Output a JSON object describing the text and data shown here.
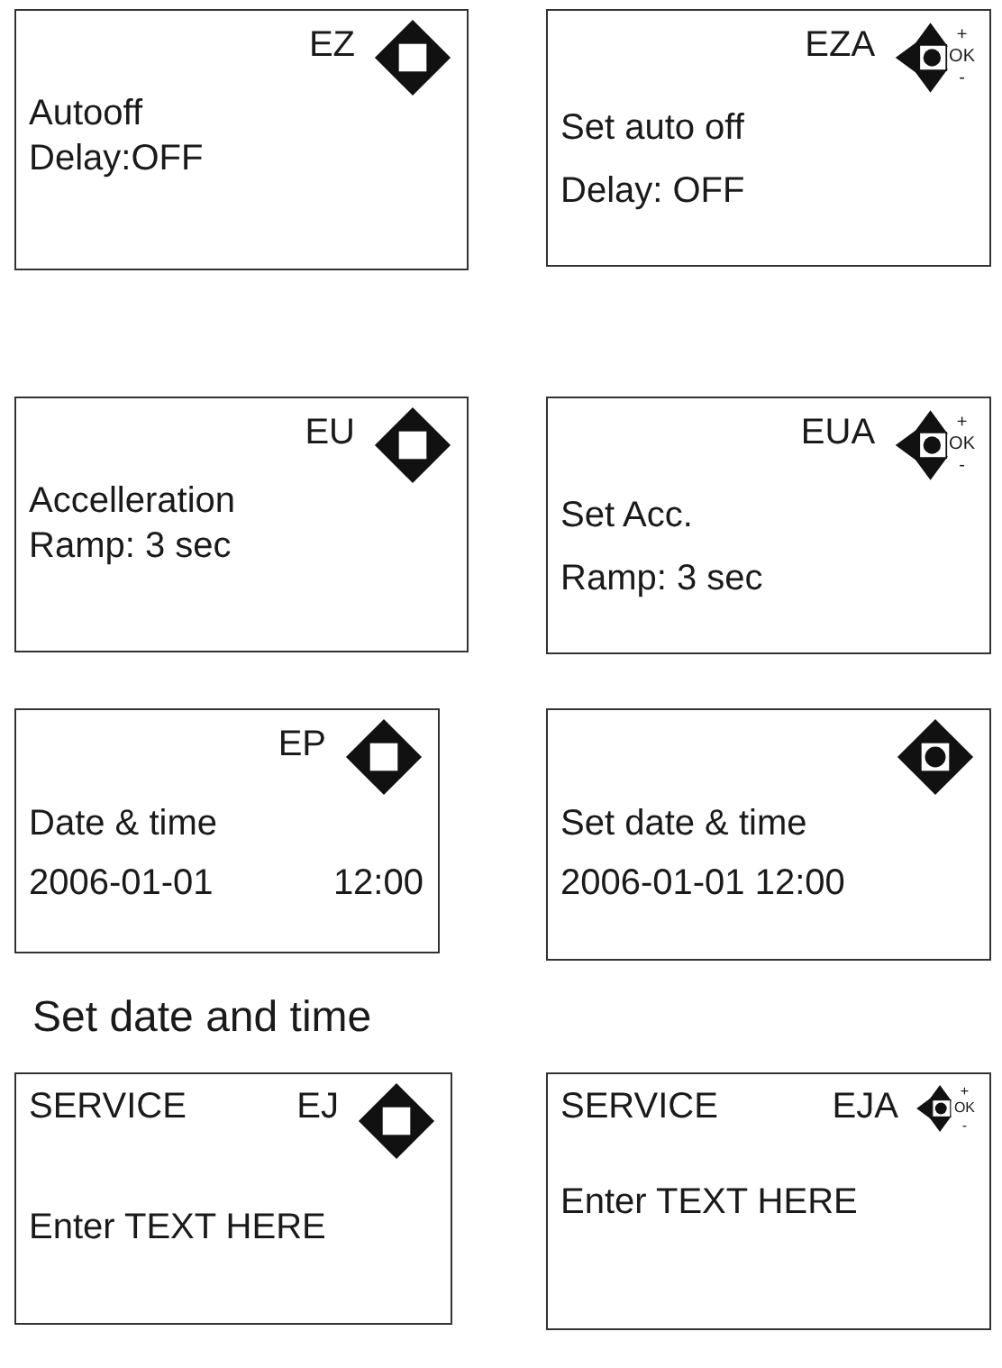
{
  "sections": [
    {
      "kind": "screens",
      "screens": [
        {
          "code": "EZ",
          "icon": {
            "kind": "nav"
          },
          "lines": [
            {
              "text": "Autooff"
            },
            {
              "text": "Delay:OFF"
            }
          ]
        },
        {
          "code": "EZA",
          "icon": {
            "kind": "edit",
            "plus": "+",
            "ok": "OK",
            "minus": "-"
          },
          "lines": [
            {
              "text": "Set auto off"
            },
            {
              "text": "Delay:  OFF"
            }
          ]
        }
      ]
    },
    {
      "kind": "screens",
      "screens": [
        {
          "code": "EU",
          "icon": {
            "kind": "nav"
          },
          "lines": [
            {
              "text": "Accelleration"
            },
            {
              "text": "Ramp: 3 sec"
            }
          ]
        },
        {
          "code": "EUA",
          "icon": {
            "kind": "edit",
            "plus": "+",
            "ok": "OK",
            "minus": "-"
          },
          "lines": [
            {
              "text": "Set Acc."
            },
            {
              "text": "Ramp: 3 sec"
            }
          ]
        }
      ]
    },
    {
      "kind": "screens",
      "screens": [
        {
          "code": "EP",
          "icon": {
            "kind": "nav"
          },
          "lines": [
            {
              "text": "Date & time"
            },
            {
              "text": "2006-01-01",
              "right": "12:00"
            }
          ]
        },
        {
          "icon": {
            "kind": "select"
          },
          "lines": [
            {
              "text": "Set date & time"
            },
            {
              "text": "2006-01-01 12:00"
            }
          ]
        }
      ]
    },
    {
      "kind": "heading",
      "text": "Set date and time"
    },
    {
      "kind": "screens",
      "screens": [
        {
          "title": "SERVICE",
          "code": "EJ",
          "icon": {
            "kind": "nav"
          },
          "lines": [
            {
              "text": "Enter TEXT HERE"
            }
          ]
        },
        {
          "title": "SERVICE",
          "code": "EJA",
          "icon": {
            "kind": "edit",
            "small": true,
            "plus": "+",
            "ok": "OK",
            "minus": "-"
          },
          "lines": [
            {
              "text": "Enter TEXT HERE"
            }
          ]
        }
      ]
    }
  ]
}
